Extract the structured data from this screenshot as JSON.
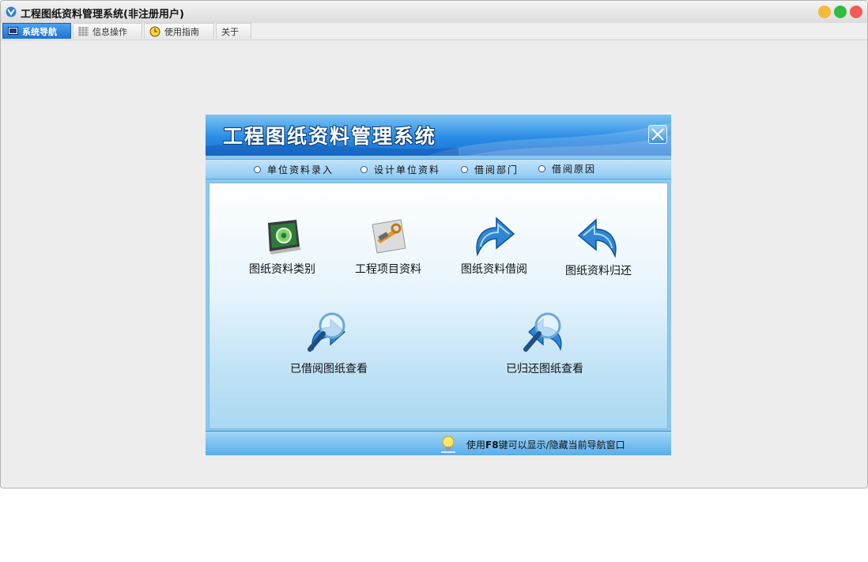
{
  "window": {
    "title": "工程图纸资料管理系统(非注册用户)"
  },
  "tabs": [
    {
      "label": "系统导航",
      "icon": "monitor-icon",
      "active": true
    },
    {
      "label": "信息操作",
      "icon": "grid-icon",
      "active": false
    },
    {
      "label": "使用指南",
      "icon": "clock-icon",
      "active": false
    },
    {
      "label": "关于",
      "icon": "",
      "active": false
    }
  ],
  "panel": {
    "title": "工程图纸资料管理系统",
    "menu": [
      {
        "label": "单位资料录入"
      },
      {
        "label": "设计单位资料"
      },
      {
        "label": "借阅部门"
      },
      {
        "label": "借阅原因"
      }
    ],
    "actions": [
      {
        "label": "图纸资料类别",
        "icon": "gear-monitor-icon"
      },
      {
        "label": "工程项目资料",
        "icon": "tools-icon"
      },
      {
        "label": "图纸资料借阅",
        "icon": "arrow-right-icon"
      },
      {
        "label": "图纸资料归还",
        "icon": "arrow-left-icon"
      },
      {
        "label": "已借阅图纸查看",
        "icon": "magnifier-arrow-right-icon"
      },
      {
        "label": "已归还图纸查看",
        "icon": "magnifier-arrow-left-icon"
      }
    ],
    "footer": {
      "hint_prefix": "使用",
      "hint_key": "F8",
      "hint_suffix": "键可以显示/隐藏当前导航窗口"
    }
  },
  "colors": {
    "accent": "#1f6fd0",
    "panel_bg": "#8cc8ee",
    "close": "#f25a55",
    "minimize": "#f5b83b",
    "maximize": "#2fbd44"
  }
}
